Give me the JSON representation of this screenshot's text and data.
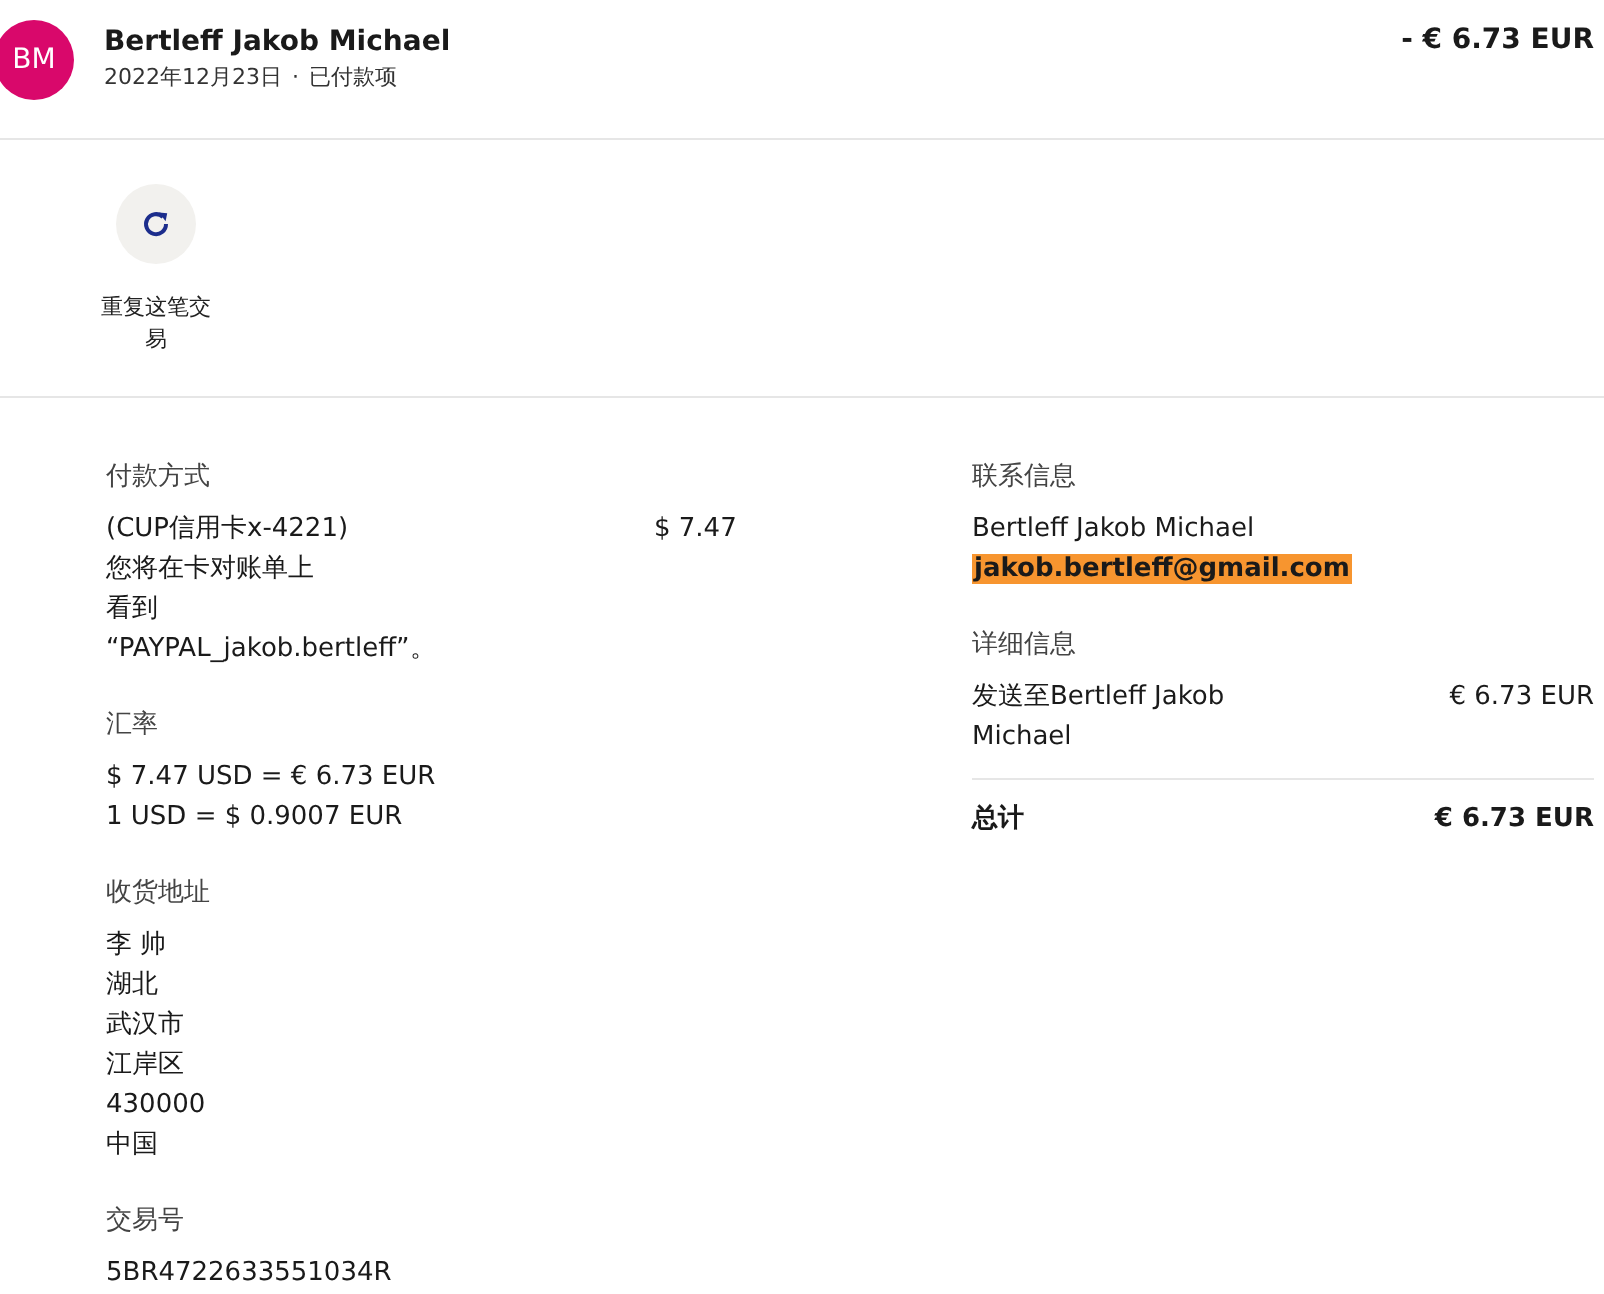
{
  "header": {
    "avatar": "BM",
    "name": "Bertleff Jakob Michael",
    "date": "2022年12月23日",
    "separator": "·",
    "status": "已付款项",
    "amount": "- € 6.73 EUR"
  },
  "actions": [
    {
      "label": "重复这笔交易"
    }
  ],
  "payment": {
    "heading": "付款方式",
    "method": "(CUP信用卡x-4221)",
    "amount": "$ 7.47",
    "note_lines": [
      "您将在卡对账单上",
      "看到",
      "“PAYPAL_jakob.bertleff”。"
    ]
  },
  "exchange": {
    "heading": "汇率",
    "lines": [
      "$ 7.47 USD = € 6.73 EUR",
      "1 USD = $ 0.9007 EUR"
    ]
  },
  "shipping": {
    "heading": "收货地址",
    "lines": [
      "李 帅",
      "湖北",
      "武汉市",
      "江岸区",
      "430000",
      "中国"
    ]
  },
  "transaction": {
    "heading": "交易号",
    "id": "5BR4722633551034R"
  },
  "contact": {
    "heading": "联系信息",
    "name": "Bertleff Jakob Michael",
    "email": {
      "text": "jakob.bertleff@gmail.com",
      "highlighted": true
    }
  },
  "details": {
    "heading": "详细信息",
    "items": [
      {
        "label": "发送至Bertleff Jakob Michael",
        "amount": "€ 6.73 EUR"
      }
    ],
    "total": {
      "label": "总计",
      "amount": "€ 6.73 EUR"
    }
  }
}
